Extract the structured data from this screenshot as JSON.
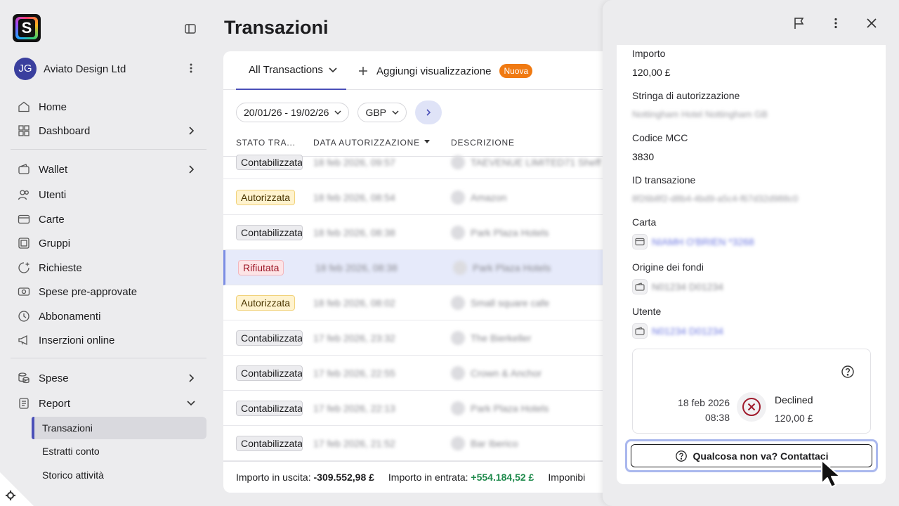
{
  "sidebar": {
    "logo_letter": "S",
    "org": {
      "initials": "JG",
      "name": "Aviato Design Ltd"
    },
    "nav": [
      {
        "label": "Home"
      },
      {
        "label": "Dashboard"
      },
      {
        "label": "Wallet"
      },
      {
        "label": "Utenti"
      },
      {
        "label": "Carte"
      },
      {
        "label": "Gruppi"
      },
      {
        "label": "Richieste"
      },
      {
        "label": "Spese pre-approvate"
      },
      {
        "label": "Abbonamenti"
      },
      {
        "label": "Inserzioni online"
      },
      {
        "label": "Spese"
      },
      {
        "label": "Report"
      }
    ],
    "sub": [
      {
        "label": "Transazioni"
      },
      {
        "label": "Estratti conto"
      },
      {
        "label": "Storico attività"
      }
    ]
  },
  "main": {
    "title": "Transazioni",
    "tab_all": "All Transactions",
    "add_view": "Aggiungi visualizzazione",
    "badge_new": "Nuova",
    "date_range": "20/01/26 - 19/02/26",
    "currency": "GBP",
    "columns": [
      "STATO TRA...",
      "DATA AUTORIZZAZIONE",
      "DESCRIZIONE"
    ],
    "rows": [
      {
        "status": "Contabilizzata",
        "date": "18 feb 2026, 09:57",
        "desc": "TAEVENUE LIMITED71 Sheff"
      },
      {
        "status": "Autorizzata",
        "date": "18 feb 2026, 08:54",
        "desc": "Amazon"
      },
      {
        "status": "Contabilizzata",
        "date": "18 feb 2026, 08:38",
        "desc": "Park Plaza Hotels"
      },
      {
        "status": "Rifiutata",
        "date": "18 feb 2026, 08:38",
        "desc": "Park Plaza Hotels"
      },
      {
        "status": "Autorizzata",
        "date": "18 feb 2026, 08:02",
        "desc": "Small square cafe"
      },
      {
        "status": "Contabilizzata",
        "date": "17 feb 2026, 23:32",
        "desc": "The Bierkeller"
      },
      {
        "status": "Contabilizzata",
        "date": "17 feb 2026, 22:55",
        "desc": "Crown & Anchor"
      },
      {
        "status": "Contabilizzata",
        "date": "17 feb 2026, 22:13",
        "desc": "Park Plaza Hotels"
      },
      {
        "status": "Contabilizzata",
        "date": "17 feb 2026, 21:52",
        "desc": "Bar Iberico"
      }
    ],
    "footer": {
      "out_label": "Importo in uscita:",
      "out_value": "-309.552,98 £",
      "in_label": "Importo in entrata:",
      "in_value": "+554.184,52 £",
      "tax_label": "Imponibi"
    }
  },
  "drawer": {
    "fields": [
      {
        "label": "Importo",
        "value": "120,00 £"
      },
      {
        "label": "Stringa di autorizzazione",
        "value": "Nottingham Hotel Nottingham GB"
      },
      {
        "label": "Codice MCC",
        "value": "3830"
      },
      {
        "label": "ID transazione",
        "value": "8f26b8f2-d8b4-4bd9-a5c4-f67d32d988c0"
      },
      {
        "label": "Carta",
        "value": "NIAMH O'BRIEN *3268"
      },
      {
        "label": "Origine dei fondi",
        "value": "N01234 D01234"
      },
      {
        "label": "Utente",
        "value": "N01234 D01234"
      }
    ],
    "timeline": {
      "date": "18 feb 2026",
      "time": "08:38",
      "state": "Declined",
      "amount": "120,00 £"
    },
    "contact": "Qualcosa non va? Contattaci"
  }
}
